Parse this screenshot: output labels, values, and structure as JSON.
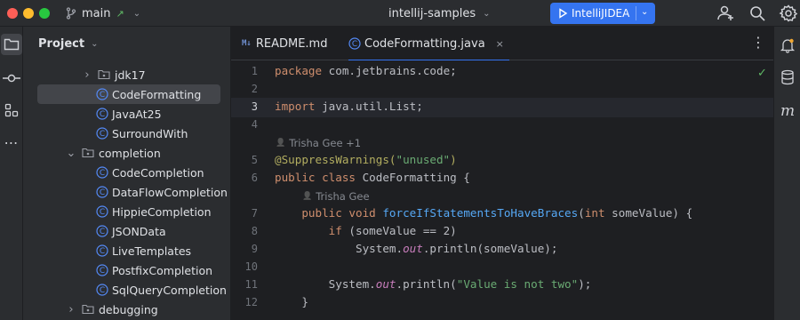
{
  "titlebar": {
    "branch": "main",
    "project": "intellij-samples",
    "run_config": "IntelliJIDEA"
  },
  "project_panel": {
    "title": "Project",
    "tree": [
      {
        "label": "jdk17",
        "kind": "folder",
        "indent": 1,
        "expanded": false
      },
      {
        "label": "CodeFormatting",
        "kind": "class",
        "indent": 2,
        "selected": true
      },
      {
        "label": "JavaAt25",
        "kind": "class",
        "indent": 2
      },
      {
        "label": "SurroundWith",
        "kind": "class",
        "indent": 2
      },
      {
        "label": "completion",
        "kind": "folder",
        "indent": 0,
        "expanded": true
      },
      {
        "label": "CodeCompletion",
        "kind": "class",
        "indent": 2
      },
      {
        "label": "DataFlowCompletion",
        "kind": "class",
        "indent": 2
      },
      {
        "label": "HippieCompletion",
        "kind": "class",
        "indent": 2
      },
      {
        "label": "JSONData",
        "kind": "class",
        "indent": 2
      },
      {
        "label": "LiveTemplates",
        "kind": "class",
        "indent": 2
      },
      {
        "label": "PostfixCompletion",
        "kind": "class",
        "indent": 2
      },
      {
        "label": "SqlQueryCompletion",
        "kind": "class",
        "indent": 2
      },
      {
        "label": "debugging",
        "kind": "folder",
        "indent": 0,
        "expanded": false
      }
    ]
  },
  "tabs": [
    {
      "label": "README.md",
      "icon": "M↓"
    },
    {
      "label": "CodeFormatting.java",
      "active": true,
      "close": "×"
    }
  ],
  "editor": {
    "lines": [
      {
        "n": "1",
        "parts": [
          [
            "kw",
            "package "
          ],
          [
            "plain",
            "com.jetbrains.code;"
          ]
        ]
      },
      {
        "n": "2",
        "parts": []
      },
      {
        "n": "3",
        "parts": [
          [
            "kw",
            "import "
          ],
          [
            "plain",
            "java.util.List;"
          ]
        ],
        "current": true
      },
      {
        "n": "4",
        "parts": []
      },
      {
        "n": "",
        "author": "Trisha Gee +1"
      },
      {
        "n": "5",
        "parts": [
          [
            "ann",
            "@SuppressWarnings("
          ],
          [
            "str",
            "\"unused\""
          ],
          [
            "ann",
            ")"
          ]
        ]
      },
      {
        "n": "6",
        "parts": [
          [
            "kw",
            "public class "
          ],
          [
            "plain",
            "CodeFormatting {"
          ]
        ]
      },
      {
        "n": "",
        "author": "Trisha Gee",
        "authorIndent": 1
      },
      {
        "n": "7",
        "parts": [
          [
            "plain",
            "    "
          ],
          [
            "kw",
            "public void "
          ],
          [
            "fn",
            "forceIfStatementsToHaveBraces"
          ],
          [
            "plain",
            "("
          ],
          [
            "kw",
            "int "
          ],
          [
            "plain",
            "someValue) {"
          ]
        ]
      },
      {
        "n": "8",
        "parts": [
          [
            "plain",
            "        "
          ],
          [
            "kw",
            "if "
          ],
          [
            "plain",
            "(someValue == "
          ],
          [
            "plain",
            "2"
          ],
          [
            "plain",
            ")"
          ]
        ]
      },
      {
        "n": "9",
        "parts": [
          [
            "plain",
            "            System."
          ],
          [
            "it",
            "out"
          ],
          [
            "plain",
            ".println(someValue);"
          ]
        ]
      },
      {
        "n": "10",
        "parts": []
      },
      {
        "n": "11",
        "parts": [
          [
            "plain",
            "        System."
          ],
          [
            "it",
            "out"
          ],
          [
            "plain",
            ".println("
          ],
          [
            "str",
            "\"Value is not two\""
          ],
          [
            "plain",
            ");"
          ]
        ]
      },
      {
        "n": "12",
        "parts": [
          [
            "plain",
            "    }"
          ]
        ]
      }
    ]
  },
  "icons": {
    "left": [
      "project-folder-icon",
      "commit-icon",
      "structure-icon",
      "more-icon"
    ],
    "right": [
      "notifications-icon",
      "database-icon",
      "m-plugin-icon"
    ],
    "top": [
      "add-user-icon",
      "search-icon",
      "settings-icon"
    ]
  }
}
